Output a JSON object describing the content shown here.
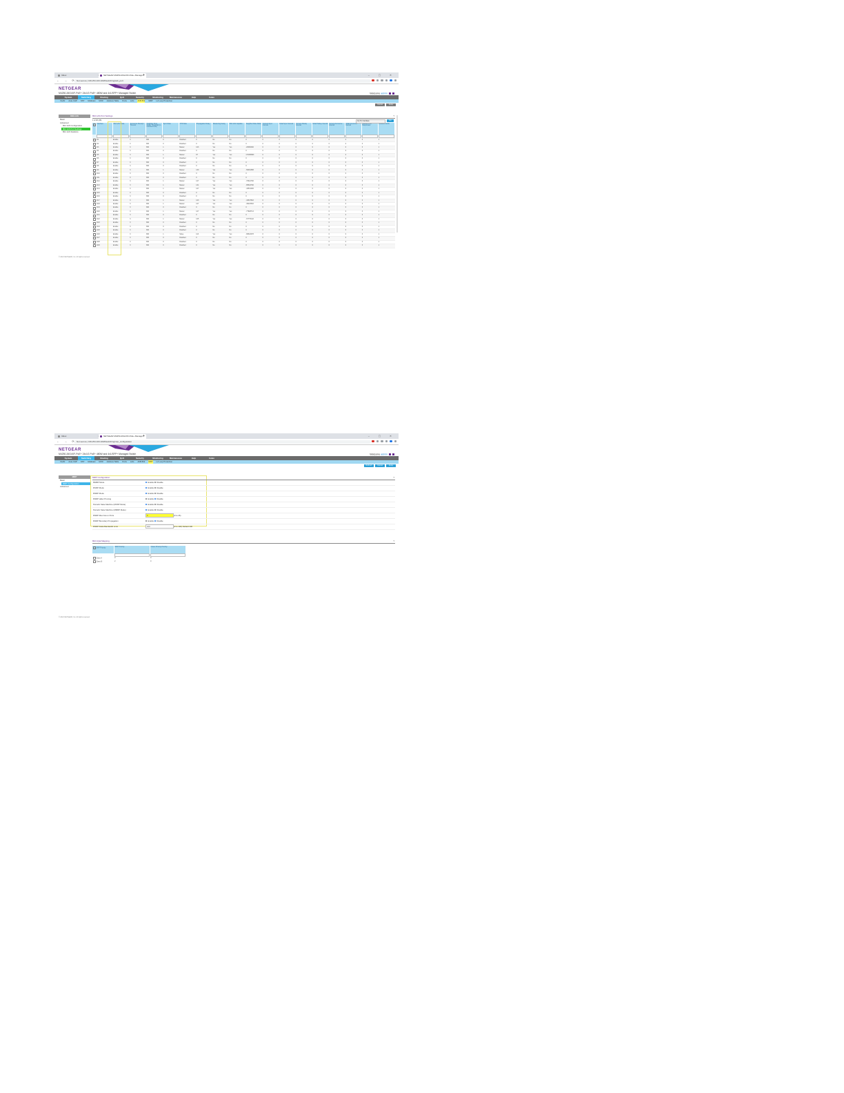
{
  "browser": {
    "tab_inactive_1": "Inbox",
    "tab_active_1": "NETGEAR M4250-26G4XF-PoE+ Manage",
    "tab_inactive_2": "Inbox",
    "tab_active_2": "NETGEAR M4250-26G4XF-PoE+ Manage",
    "close": "×",
    "new_tab": "+",
    "win_controls": "– ▢ ✕",
    "nav_controls": "← → ⟳",
    "url": "Not secure | 169.254.100.100/#/switching/avb_port",
    "url_2": "Not secure | 169.254.100.100/#/switching/mrp_configuration"
  },
  "header": {
    "logo": "NETGEAR",
    "model": "M4250-26G4XF-PoE+ 24x1G PoE+ 480W and 4x1/SFP+ Managed Switch",
    "welcome": "Welcome",
    "user": "admin"
  },
  "topnav": [
    "System",
    "Switching",
    "Routing",
    "QoS",
    "Security",
    "Monitoring",
    "Maintenance",
    "Help",
    "Index"
  ],
  "subnav_1": [
    "VLAN",
    "Auto-VoIP",
    "STP",
    "Multicast",
    "MVR",
    "Address Table",
    "Ports",
    "LAG",
    "AVB 802",
    "MRP",
    "L2 Loop Protection"
  ],
  "subnav_2": [
    "VLAN",
    "Auto-VoIP",
    "STP",
    "Multicast",
    "MVR",
    "Address Table",
    "Ports",
    "LAG",
    "AVB 802",
    "MRP",
    "L2 Loop Protection"
  ],
  "buttons": {
    "cancel": "Cancel",
    "apply": "Apply",
    "refresh": "Refresh",
    "go": "Go"
  },
  "shot1": {
    "sidebar_title": "802.1AS",
    "sidebar_items": [
      "Basic",
      "Advanced",
      "802.1AS Configuration",
      "802.1AS Port Settings",
      "802.1AS Statistics"
    ],
    "section_title": "802.1AS Port Settings",
    "filter_label": "1 of 26 (26)",
    "goto_placeholder": "Go To Interface",
    "columns": [
      "Interface",
      "802.1AS Mode",
      "Announce Receipt Timeout",
      "Neighbor Prop Delay Threshold (in nanoseconds)",
      "Sync Rate",
      "PTP Role",
      "Propagation Delay",
      "Measuring Delay",
      "802.1AS Capable",
      "Neighbor Rate Ratio",
      "Current Sync Interval",
      "Initial Sync Interval",
      "Current Pdelay Interval",
      "Initial Pdelay Interval",
      "Current Announce Interval",
      "Initial Announce Interval",
      "Allowed Lost Responses",
      "Allowed Faults"
    ],
    "rows": [
      [
        "0/1",
        "Enable",
        "3",
        "800",
        "0",
        "Disabled",
        "0",
        "No",
        "No",
        "0",
        "0",
        "0",
        "0",
        "0",
        "0",
        "0",
        "3",
        "1"
      ],
      [
        "0/2",
        "Enable",
        "3",
        "800",
        "0",
        "Disabled",
        "0",
        "No",
        "No",
        "0",
        "0",
        "0",
        "0",
        "0",
        "0",
        "0",
        "3",
        "1"
      ],
      [
        "0/3",
        "Enable",
        "3",
        "800",
        "1",
        "Master",
        "123",
        "Yes",
        "Yes",
        "-20060482",
        "0",
        "0",
        "0",
        "0",
        "0",
        "0",
        "3",
        "1"
      ],
      [
        "0/4",
        "Enable",
        "3",
        "800",
        "0",
        "Disabled",
        "0",
        "No",
        "No",
        "0",
        "0",
        "0",
        "0",
        "0",
        "0",
        "0",
        "3",
        "1"
      ],
      [
        "0/5",
        "Enable",
        "3",
        "800",
        "1",
        "Master",
        "87",
        "Yes",
        "Yes",
        "170338993",
        "0",
        "0",
        "0",
        "0",
        "0",
        "0",
        "3",
        "1"
      ],
      [
        "0/6",
        "Enable",
        "3",
        "800",
        "0",
        "Disabled",
        "0",
        "No",
        "No",
        "0",
        "0",
        "0",
        "0",
        "0",
        "0",
        "0",
        "3",
        "1"
      ],
      [
        "0/7",
        "Enable",
        "3",
        "800",
        "0",
        "Disabled",
        "0",
        "No",
        "No",
        "0",
        "0",
        "0",
        "0",
        "0",
        "0",
        "0",
        "3",
        "1"
      ],
      [
        "0/8",
        "Enable",
        "3",
        "800",
        "0",
        "Disabled",
        "0",
        "No",
        "No",
        "0",
        "0",
        "0",
        "0",
        "0",
        "0",
        "0",
        "3",
        "1"
      ],
      [
        "0/9",
        "Enable",
        "3",
        "800",
        "1",
        "Master",
        "130",
        "Yes",
        "Yes",
        "-56061658",
        "0",
        "0",
        "0",
        "0",
        "0",
        "0",
        "3",
        "1"
      ],
      [
        "0/10",
        "Enable",
        "3",
        "800",
        "0",
        "Disabled",
        "0",
        "No",
        "No",
        "0",
        "0",
        "0",
        "0",
        "0",
        "0",
        "0",
        "3",
        "1"
      ],
      [
        "0/11",
        "Enable",
        "3",
        "800",
        "0",
        "Disabled",
        "0",
        "No",
        "No",
        "0",
        "0",
        "0",
        "0",
        "0",
        "0",
        "0",
        "3",
        "1"
      ],
      [
        "0/12",
        "Enable",
        "3",
        "800",
        "1",
        "Master",
        "127",
        "Yes",
        "Yes",
        "-70612782",
        "0",
        "0",
        "0",
        "0",
        "0",
        "0",
        "3",
        "1"
      ],
      [
        "0/13",
        "Enable",
        "3",
        "800",
        "1",
        "Master",
        "131",
        "Yes",
        "Yes",
        "-85524790",
        "0",
        "0",
        "0",
        "0",
        "0",
        "0",
        "3",
        "1"
      ],
      [
        "0/14",
        "Enable",
        "3",
        "800",
        "1",
        "Master",
        "127",
        "Yes",
        "Yes",
        "-43531006",
        "0",
        "0",
        "0",
        "0",
        "0",
        "0",
        "3",
        "1"
      ],
      [
        "0/15",
        "Enable",
        "3",
        "800",
        "0",
        "Disabled",
        "0",
        "No",
        "No",
        "0",
        "0",
        "0",
        "0",
        "0",
        "0",
        "0",
        "3",
        "1"
      ],
      [
        "0/16",
        "Enable",
        "3",
        "800",
        "0",
        "Disabled",
        "0",
        "No",
        "No",
        "0",
        "0",
        "0",
        "0",
        "0",
        "0",
        "0",
        "3",
        "1"
      ],
      [
        "0/17",
        "Enable",
        "3",
        "800",
        "1",
        "Master",
        "123",
        "Yes",
        "Yes",
        "-43647522",
        "0",
        "0",
        "0",
        "0",
        "0",
        "0",
        "3",
        "1"
      ],
      [
        "0/18",
        "Enable",
        "3",
        "800",
        "1",
        "Master",
        "127",
        "Yes",
        "Yes",
        "-49223632",
        "0",
        "0",
        "0",
        "0",
        "0",
        "0",
        "3",
        "1"
      ],
      [
        "0/19",
        "Enable",
        "3",
        "800",
        "0",
        "Disabled",
        "0",
        "No",
        "No",
        "0",
        "0",
        "0",
        "0",
        "0",
        "0",
        "0",
        "3",
        "1"
      ],
      [
        "0/20",
        "Enable",
        "3",
        "800",
        "1",
        "Master",
        "127",
        "Yes",
        "Yes",
        "-77828713",
        "0",
        "0",
        "0",
        "0",
        "0",
        "0",
        "3",
        "1"
      ],
      [
        "0/21",
        "Enable",
        "3",
        "800",
        "0",
        "Disabled",
        "0",
        "No",
        "No",
        "0",
        "0",
        "0",
        "0",
        "0",
        "0",
        "0",
        "3",
        "1"
      ],
      [
        "0/22",
        "Enable",
        "3",
        "800",
        "1",
        "Master",
        "125",
        "Yes",
        "Yes",
        "-67779142",
        "0",
        "0",
        "0",
        "0",
        "0",
        "0",
        "3",
        "1"
      ],
      [
        "0/23",
        "Enable",
        "3",
        "800",
        "0",
        "Disabled",
        "0",
        "No",
        "No",
        "0",
        "0",
        "0",
        "0",
        "0",
        "0",
        "0",
        "3",
        "1"
      ],
      [
        "0/24",
        "Enable",
        "3",
        "800",
        "0",
        "Disabled",
        "0",
        "No",
        "No",
        "0",
        "0",
        "0",
        "0",
        "0",
        "0",
        "0",
        "3",
        "1"
      ],
      [
        "0/25",
        "Enable",
        "3",
        "800",
        "0",
        "Disabled",
        "0",
        "No",
        "No",
        "0",
        "0",
        "0",
        "0",
        "0",
        "0",
        "0",
        "3",
        "1"
      ],
      [
        "0/26",
        "Enable",
        "3",
        "800",
        "1",
        "Slave",
        "113",
        "Yes",
        "Yes",
        "-68624378",
        "0",
        "0",
        "0",
        "0",
        "0",
        "0",
        "3",
        "1"
      ],
      [
        "0/27",
        "Enable",
        "3",
        "800",
        "0",
        "Disabled",
        "0",
        "No",
        "No",
        "0",
        "0",
        "0",
        "0",
        "0",
        "0",
        "0",
        "3",
        "1"
      ],
      [
        "0/28",
        "Enable",
        "3",
        "800",
        "0",
        "Disabled",
        "0",
        "No",
        "No",
        "0",
        "0",
        "0",
        "0",
        "0",
        "0",
        "0",
        "3",
        "1"
      ],
      [
        "0/29",
        "Enable",
        "3",
        "800",
        "0",
        "Disabled",
        "0",
        "No",
        "No",
        "0",
        "0",
        "0",
        "0",
        "0",
        "0",
        "0",
        "3",
        "1"
      ]
    ],
    "footer": "© 2021 NETGEAR, Inc. All rights reserved."
  },
  "shot2": {
    "sidebar_title": "MRP",
    "sidebar_items": [
      "Basic",
      "MRP Configuration",
      "Advanced"
    ],
    "section_title": "MRP Configuration",
    "config_rows": [
      {
        "label": "MMRP Mode",
        "opt1": "Enable",
        "opt2": "Disable",
        "on": 1
      },
      {
        "label": "MVRP Mode",
        "opt1": "Enable",
        "opt2": "Disable",
        "on": 1
      },
      {
        "label": "MSRP Mode",
        "opt1": "Enable",
        "opt2": "Disable",
        "on": 1
      },
      {
        "label": "MSRP talker Pruning",
        "opt1": "Enable",
        "opt2": "Disable",
        "on": 2
      },
      {
        "label": "Periodic State Machine (MVRP Mode)",
        "opt1": "Enable",
        "opt2": "Disable",
        "on": 1
      },
      {
        "label": "Periodic State Machine (MMRP Mode)",
        "opt1": "Enable",
        "opt2": "Disable",
        "on": 1
      }
    ],
    "max_fan_label": "MSRP Max Fan-in Ports",
    "max_fan_value": "0",
    "max_fan_range": "(0 to 26)",
    "boundary_label": "MSRP Boundary Propagation",
    "boundary_opt1": "Enable",
    "boundary_opt2": "Disable",
    "delta_label": "MSRP Delta Bandwidth Limit",
    "delta_value": "100",
    "delta_range": "(0 to 100) Default:100",
    "srp_title": "802.1Qat Mapping",
    "srp_columns": [
      "SRP Priority",
      "SRP Priority",
      "Class Priority Priority"
    ],
    "srp_rows": [
      [
        "Class A",
        "3",
        "0"
      ],
      [
        "Class B",
        "2",
        "0"
      ]
    ],
    "footer": "© 2021 NETGEAR, Inc. All rights reserved."
  },
  "colors": {
    "brand_purple": "#6a2c91",
    "accent_blue": "#3db4e8",
    "highlight_yellow": "#e8e36a",
    "sidebar_green": "#2ec42e"
  }
}
